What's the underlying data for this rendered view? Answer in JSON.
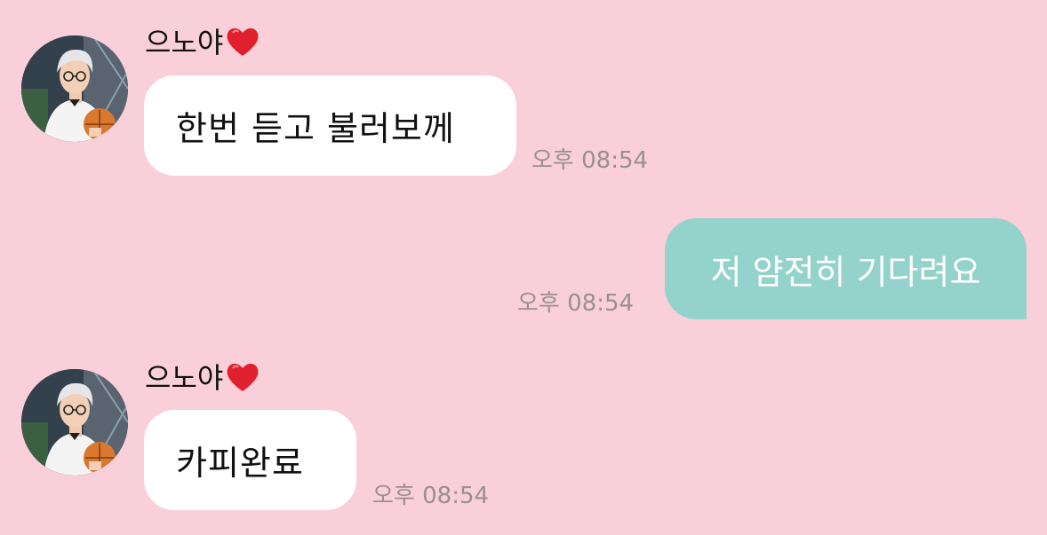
{
  "chat": {
    "messages": [
      {
        "direction": "incoming",
        "sender": "으노야",
        "text": "한번 듣고 불러보께",
        "time": "오후 08:54"
      },
      {
        "direction": "outgoing",
        "text": "저 얌전히 기다려요",
        "time": "오후 08:54"
      },
      {
        "direction": "incoming",
        "sender": "으노야",
        "text": "카피완료",
        "time": "오후 08:54"
      }
    ]
  },
  "colors": {
    "background": "#f9cfd9",
    "incoming_bubble": "#ffffff",
    "outgoing_bubble": "#93d3cb",
    "timestamp": "#9a8f93",
    "heart": "#e0202e"
  },
  "icons": {
    "sender_suffix": "heart-icon",
    "avatar": "profile-avatar"
  }
}
